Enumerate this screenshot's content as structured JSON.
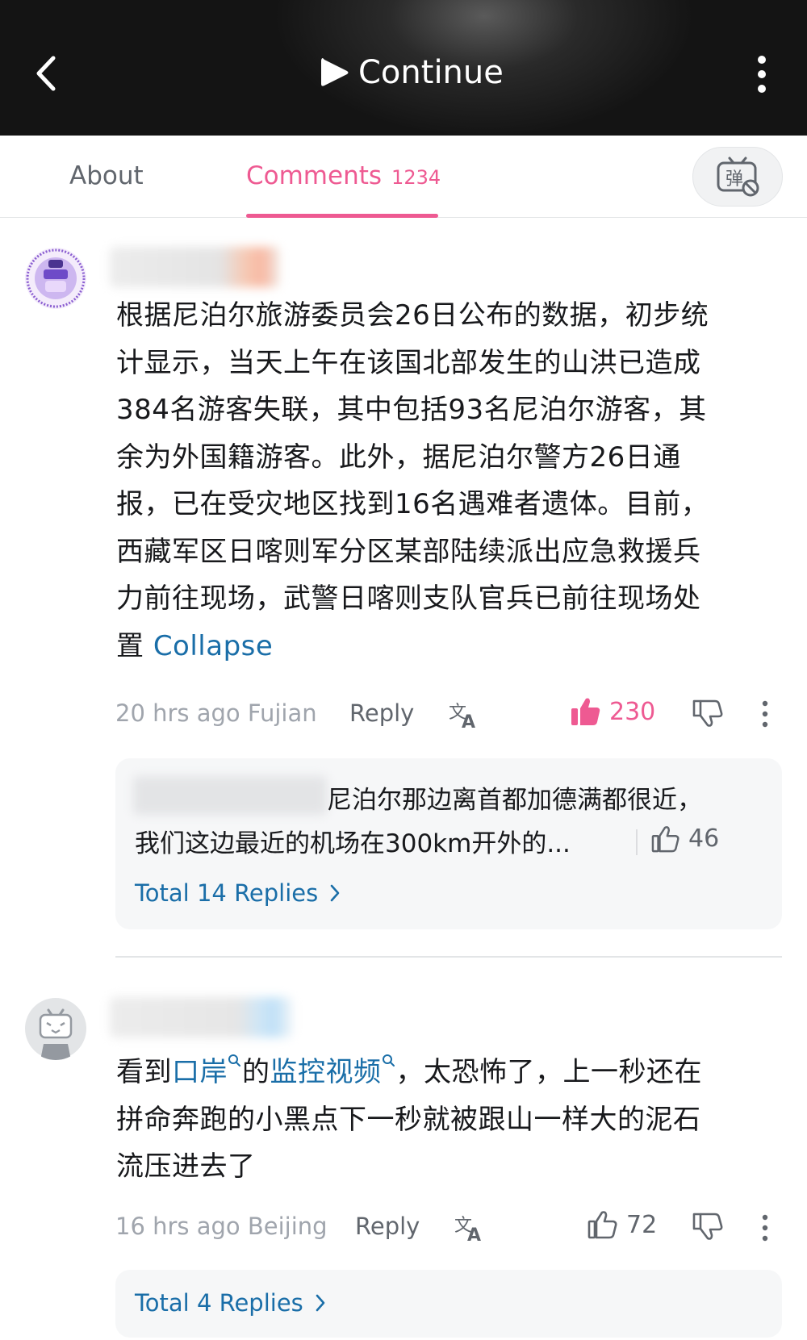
{
  "header": {
    "continue_label": "Continue",
    "back_icon": "back-arrow-icon",
    "more_icon": "more-vertical-icon",
    "play_icon": "play-icon"
  },
  "tabs": {
    "about": "About",
    "comments": "Comments",
    "comments_count": "1234",
    "active": "comments",
    "accent_color": "#ee5a92",
    "danmaku_icon": "danmaku-icon"
  },
  "comments": [
    {
      "text_lines": [
        "根据尼泊尔旅游委员会26日公布的数据，初步统",
        "计显示，当天上午在该国北部发生的山洪已造成",
        "384名游客失联，其中包括93名尼泊尔游客，其",
        "余为外国籍游客。此外，据尼泊尔警方26日通",
        "报，已在受灾地区找到16名遇难者遗体。目前，",
        "西藏军区日喀则军分区某部陆续派出应急救援兵",
        "力前往现场，武警日喀则支队官兵已前往现场处"
      ],
      "last_line_text": "置",
      "collapse_label": "Collapse",
      "time_location": "20 hrs ago Fujian",
      "reply_label": "Reply",
      "like_count": "230",
      "liked": true,
      "reply_preview": {
        "line1": "尼泊尔那边离首都加德满都很近，",
        "line2": "我们这边最近的机场在300km开外的...",
        "like_count": "46"
      },
      "total_replies": "Total 14 Replies"
    },
    {
      "text_parts": {
        "a": "看到",
        "link1": "口岸",
        "b": "的",
        "link2": "监控视频",
        "c": "，太恐怖了，上一秒还在"
      },
      "text_lines": [
        "拼命奔跑的小黑点下一秒就被跟山一样大的泥石",
        "流压进去了"
      ],
      "time_location": "16 hrs ago Beijing",
      "reply_label": "Reply",
      "like_count": "72",
      "liked": false,
      "total_replies": "Total 4 Replies"
    }
  ]
}
